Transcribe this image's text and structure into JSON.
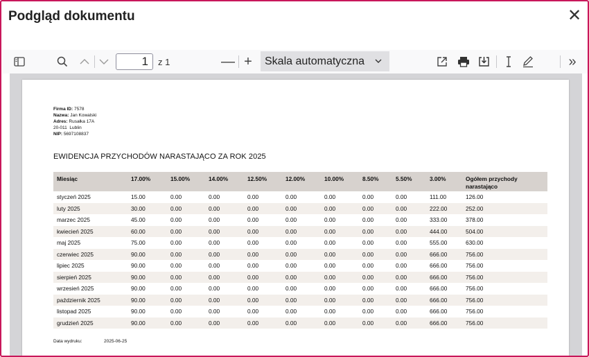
{
  "dialog": {
    "title": "Podgląd dokumentu"
  },
  "toolbar": {
    "page_number": "1",
    "page_of": "z 1",
    "zoom_minus": "—",
    "zoom_plus": "+",
    "scale": "Skala automatyczna",
    "more": "»"
  },
  "document": {
    "company": {
      "id_label": "Firma ID:",
      "id": "7578",
      "name_label": "Nazwa:",
      "name": "Jan Kowalski",
      "address_label": "Adres:",
      "address": "Rusałka 17A",
      "city": "20-011  Lublin",
      "nip_label": "NIP:",
      "nip": "5697108837"
    },
    "title": "EWIDENCJA PRZYCHODÓW NARASTAJĄCO ZA ROK 2025",
    "columns": [
      "Miesiąc",
      "17.00%",
      "15.00%",
      "14.00%",
      "12.50%",
      "12.00%",
      "10.00%",
      "8.50%",
      "5.50%",
      "3.00%",
      "Ogółem przychody narastająco"
    ],
    "rows": [
      [
        "styczeń 2025",
        "15.00",
        "0.00",
        "0.00",
        "0.00",
        "0.00",
        "0.00",
        "0.00",
        "0.00",
        "111.00",
        "126.00"
      ],
      [
        "luty 2025",
        "30.00",
        "0.00",
        "0.00",
        "0.00",
        "0.00",
        "0.00",
        "0.00",
        "0.00",
        "222.00",
        "252.00"
      ],
      [
        "marzec 2025",
        "45.00",
        "0.00",
        "0.00",
        "0.00",
        "0.00",
        "0.00",
        "0.00",
        "0.00",
        "333.00",
        "378.00"
      ],
      [
        "kwiecień 2025",
        "60.00",
        "0.00",
        "0.00",
        "0.00",
        "0.00",
        "0.00",
        "0.00",
        "0.00",
        "444.00",
        "504.00"
      ],
      [
        "maj 2025",
        "75.00",
        "0.00",
        "0.00",
        "0.00",
        "0.00",
        "0.00",
        "0.00",
        "0.00",
        "555.00",
        "630.00"
      ],
      [
        "czerwiec 2025",
        "90.00",
        "0.00",
        "0.00",
        "0.00",
        "0.00",
        "0.00",
        "0.00",
        "0.00",
        "666.00",
        "756.00"
      ],
      [
        "lipiec 2025",
        "90.00",
        "0.00",
        "0.00",
        "0.00",
        "0.00",
        "0.00",
        "0.00",
        "0.00",
        "666.00",
        "756.00"
      ],
      [
        "sierpień 2025",
        "90.00",
        "0.00",
        "0.00",
        "0.00",
        "0.00",
        "0.00",
        "0.00",
        "0.00",
        "666.00",
        "756.00"
      ],
      [
        "wrzesień 2025",
        "90.00",
        "0.00",
        "0.00",
        "0.00",
        "0.00",
        "0.00",
        "0.00",
        "0.00",
        "666.00",
        "756.00"
      ],
      [
        "październik 2025",
        "90.00",
        "0.00",
        "0.00",
        "0.00",
        "0.00",
        "0.00",
        "0.00",
        "0.00",
        "666.00",
        "756.00"
      ],
      [
        "listopad 2025",
        "90.00",
        "0.00",
        "0.00",
        "0.00",
        "0.00",
        "0.00",
        "0.00",
        "0.00",
        "666.00",
        "756.00"
      ],
      [
        "grudzień 2025",
        "90.00",
        "0.00",
        "0.00",
        "0.00",
        "0.00",
        "0.00",
        "0.00",
        "0.00",
        "666.00",
        "756.00"
      ]
    ],
    "print_date_label": "Data wydruku:",
    "print_date": "2025-06-25"
  },
  "colors": {
    "border_accent": "#c8175a",
    "table_header_bg": "#d7d2ce",
    "alt_row_bg": "#f3efeb",
    "viewer_bg": "#d4d4d7"
  }
}
